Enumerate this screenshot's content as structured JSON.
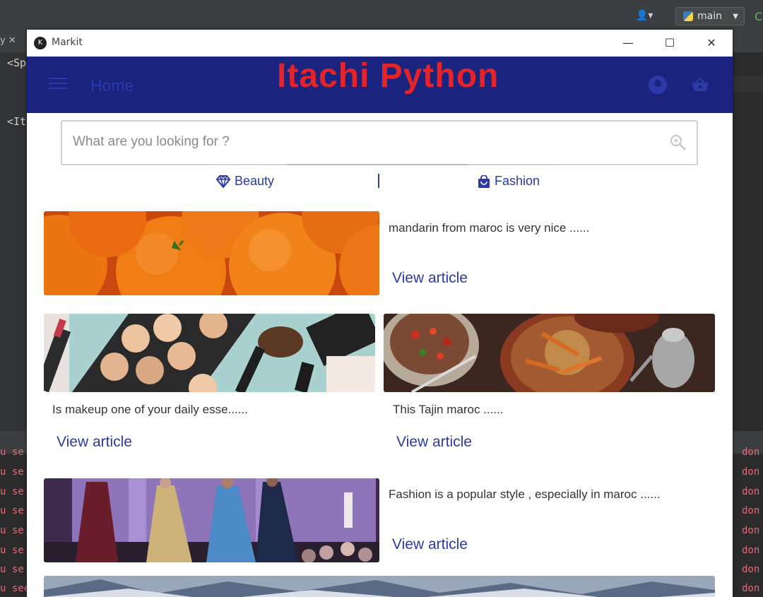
{
  "ide": {
    "branch": "main",
    "tab_fragment": "y ✕",
    "code_lines": [
      "<Sp",
      "<It"
    ],
    "console": {
      "fragment_left": "u se",
      "fragment_right": "don",
      "bottom_line": "u see this error, this means that either youre using  CommonElevationBehavio r directly or your 'shader'"
    }
  },
  "window": {
    "title": "Markit",
    "controls": {
      "minimize": "—",
      "maximize": "☐",
      "close": "✕"
    }
  },
  "appbar": {
    "title": "Home",
    "banner": "Itachi Python"
  },
  "search": {
    "placeholder": "What are you looking for ?"
  },
  "categories": [
    {
      "label": "Beauty",
      "icon": "diamond-icon"
    },
    {
      "label": "Fashion",
      "icon": "shopping-bag-icon"
    }
  ],
  "articles": [
    {
      "text": "mandarin from maroc is very nice ......",
      "link": "View article"
    },
    {
      "text": "Is makeup one of your daily esse......",
      "link": "View article"
    },
    {
      "text": "This Tajin maroc ......",
      "link": "View article"
    },
    {
      "text": "Fashion is a popular style , especially in maroc ......",
      "link": "View article"
    }
  ],
  "colors": {
    "appbar": "#1a237e",
    "accent": "#2c3aa8",
    "banner": "#e5242a"
  }
}
